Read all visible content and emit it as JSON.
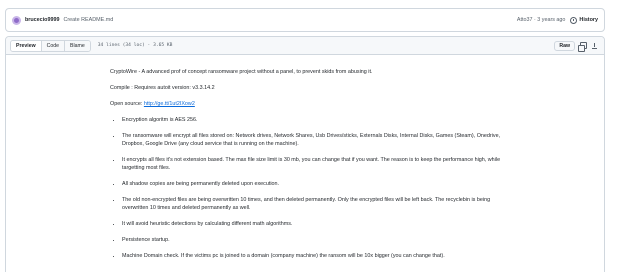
{
  "commit": {
    "author": "brucecio9999",
    "message": "Create README.md",
    "hash_time": "Atto37 · 3 years ago",
    "history_label": "History"
  },
  "file_header": {
    "tabs": [
      "Preview",
      "Code",
      "Blame"
    ],
    "active_tab": "Preview",
    "info": "34 lines (34 loc) · 3.65 KB",
    "raw_label": "Raw"
  },
  "readme": {
    "intro": "CryptoWire - A advanced prof of concept ransomware project without a panel, to prevent skids from abusing it.",
    "compile": "Compile : Requires autoit version: v3.3.14.2",
    "open_source_label": "Open source: ",
    "open_source_link": "http://ge.tt/1ut2IXow2",
    "bullets": [
      "Encryption algoritm is AES 256.",
      "The ransomware will encrypt all files stored on: Network drives, Network Shares, Usb Drives/sticks, Externals Disks, Internal Disks, Games (Steam), Onedrive, Dropbox, Google Drive (any cloud service that is running on the machine).",
      "It encrypts all files it's not extension based. The max file size limit is 30 mb, you can change that if you want. The reason is to keep the performance high, while targetting most files.",
      "All shadow copies are being permanently deleted upon execution.",
      "The old non-encrypted files are being overwritten 10 times, and then deleted permanently. Only the encrypted files will be left back. The recyclebin is being overwritten 10 times and deleted permanently as well.",
      "It will avoid heuristic detections by calculating different math algorithms.",
      "Persistence startup.",
      "Machine Domain check. If the victims pc is joined to a domain (company machine) the ransom will be 10x bigger (you can change that)."
    ]
  },
  "colors": {
    "link": "#0969da",
    "border": "#d0d7de",
    "header_bg": "#f6f8fa"
  }
}
